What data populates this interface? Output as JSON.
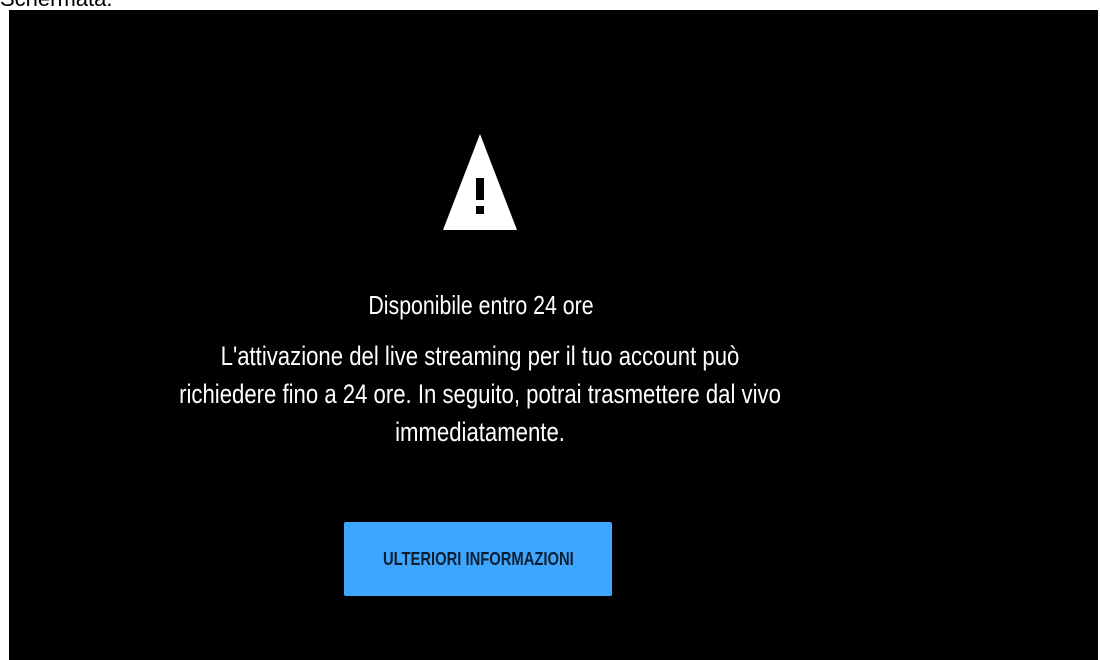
{
  "caption": "Schermata.",
  "player": {
    "icon": "warning-triangle-icon",
    "title": "Disponibile entro 24 ore",
    "message": "L'attivazione del live streaming per il tuo account può richiedere fino a 24 ore. In seguito, potrai trasmettere dal vivo immediatamente.",
    "button_label": "ULTERIORI INFORMAZIONI"
  },
  "colors": {
    "background": "#000000",
    "text": "#ffffff",
    "button_bg": "#3ea6ff",
    "button_text": "#0b1f33"
  }
}
